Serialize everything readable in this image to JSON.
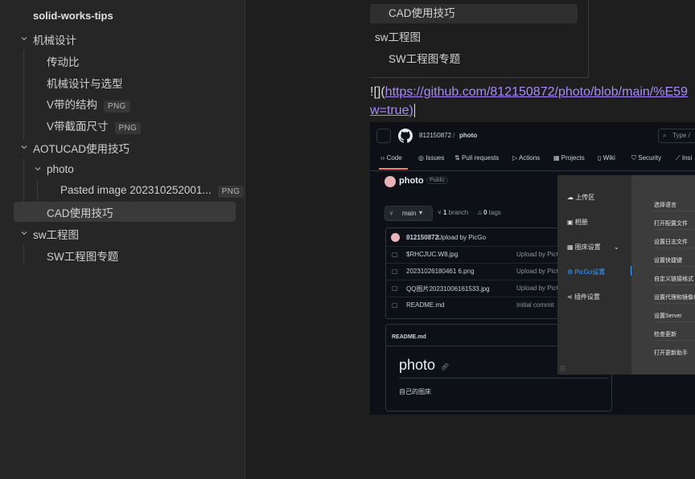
{
  "sidebar": {
    "vault_title": "solid-works-tips",
    "items": [
      {
        "label": "机械设计",
        "type": "folder"
      },
      {
        "label": "传动比"
      },
      {
        "label": "机械设计与选型"
      },
      {
        "label": "V带的结构",
        "badge": "PNG"
      },
      {
        "label": "V带截面尺寸",
        "badge": "PNG"
      },
      {
        "label": "AOTUCAD使用技巧",
        "type": "folder"
      },
      {
        "label": "photo",
        "type": "folder"
      },
      {
        "label": "Pasted image 202310252001...",
        "badge": "PNG"
      },
      {
        "label": "CAD使用技巧",
        "active": true
      },
      {
        "label": "sw工程图",
        "type": "folder"
      },
      {
        "label": "SW工程图专题"
      }
    ]
  },
  "toc": {
    "items": [
      "CAD使用技巧",
      "sw工程图",
      "SW工程图专题"
    ]
  },
  "editor": {
    "link_prefix": "![](",
    "link_url_line1": "https://github.com/812150872/photo/blob/main/%E59",
    "link_url_line2": "w=true",
    "link_suffix": ")"
  },
  "github": {
    "owner": "812150872",
    "separator": "/",
    "repo": "photo",
    "search_placeholder": "Type /",
    "tabs": [
      "Code",
      "Issues",
      "Pull requests",
      "Actions",
      "Projects",
      "Wiki",
      "Security",
      "Insi"
    ],
    "repo_title": "photo",
    "visibility": "Public",
    "branch": "main",
    "branches_count": "1",
    "branches_label": "branch",
    "tags_count": "0",
    "tags_label": "tags",
    "commit_author": "812150872",
    "commit_message": "Upload by PicGo",
    "files": [
      {
        "name": "$RHCJUC.W8.jpg",
        "msg": "Upload by PicG"
      },
      {
        "name": "20231026180461 6.png",
        "msg": "Upload by PicG"
      },
      {
        "name": "QQ图片20231006161533.jpg",
        "msg": "Upload by PicG"
      },
      {
        "name": "README.md",
        "msg": "Initial commit"
      }
    ],
    "readme_label": "README.md",
    "readme_title": "photo",
    "readme_body": "自己的图床"
  },
  "picgo_menu": {
    "left_items": [
      "上传区",
      "相册",
      "图床设置",
      "PicGo设置",
      "插件设置"
    ],
    "right_items": [
      "选择语言",
      "打开配置文件",
      "设置日志文件",
      "设置快捷键",
      "自定义链接格式",
      "设置代理和镜像地址",
      "设置Server",
      "检查更新",
      "打开更新助手"
    ]
  },
  "colors": {
    "link": "#a88bfa",
    "active_row": "#3a3a3a",
    "picgo_accent": "#409eff"
  }
}
